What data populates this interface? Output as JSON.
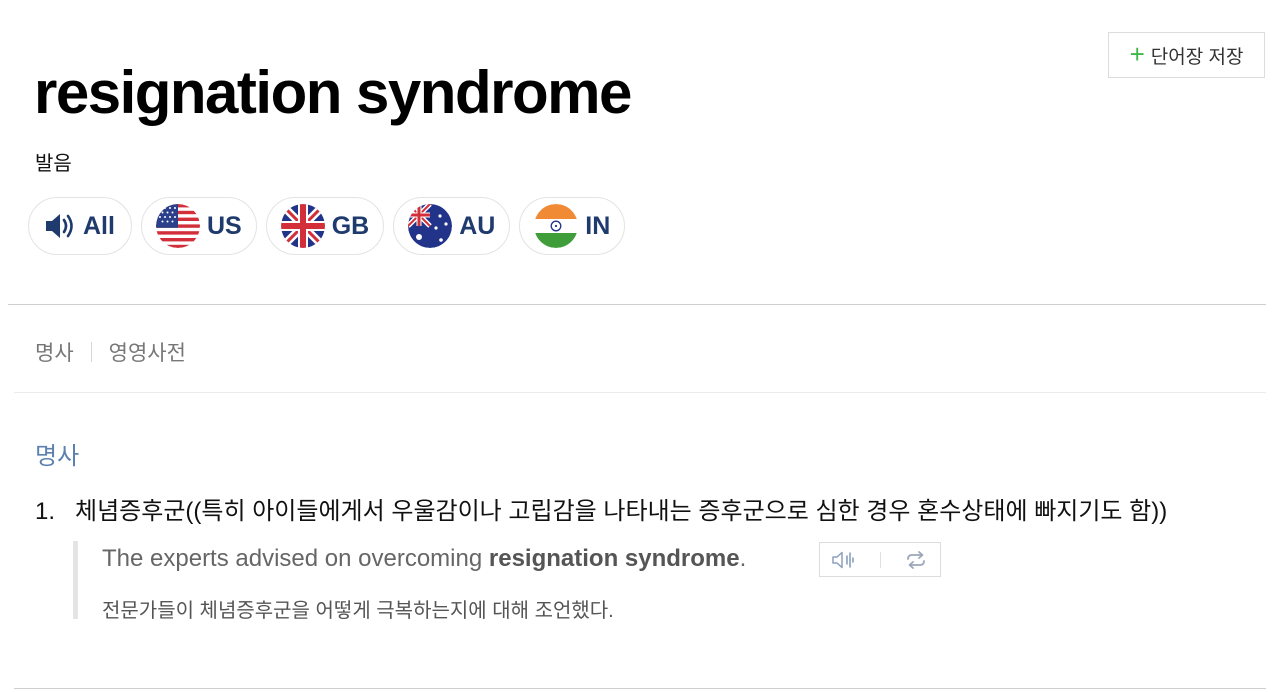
{
  "header": {
    "save_label": "단어장 저장",
    "headword": "resignation syndrome"
  },
  "pronunciation": {
    "label": "발음",
    "buttons": [
      {
        "code": "All",
        "icon": "speaker-icon"
      },
      {
        "code": "US",
        "icon": "us-flag-icon"
      },
      {
        "code": "GB",
        "icon": "gb-flag-icon"
      },
      {
        "code": "AU",
        "icon": "au-flag-icon"
      },
      {
        "code": "IN",
        "icon": "in-flag-icon"
      }
    ]
  },
  "tabs": {
    "part_of_speech": "명사",
    "dictionary": "영영사전"
  },
  "entry": {
    "pos": "명사",
    "definitions": [
      {
        "number": "1.",
        "text": "체념증후군((특히 아이들에게서 우울감이나 고립감을 나타내는 증후군으로 심한 경우 혼수상태에 빠지기도 함))",
        "example": {
          "en_before": "The experts advised on overcoming ",
          "en_bold": "resignation syndrome",
          "en_after": ".",
          "ko": "전문가들이 체념증후군을 어떻게 극복하는지에 대해 조언했다."
        }
      }
    ]
  },
  "colors": {
    "accent_plus": "#3cb84a",
    "pron_code": "#1f3b6e",
    "pos_blue": "#5c80b0"
  }
}
